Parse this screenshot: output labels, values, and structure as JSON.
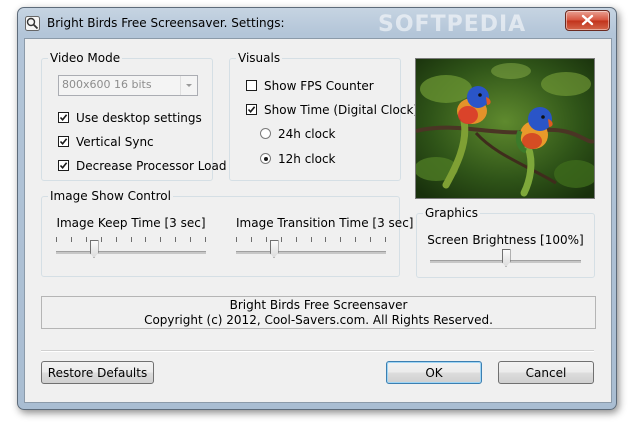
{
  "window": {
    "title": "Bright Birds Free Screensaver. Settings:",
    "watermark": "SOFTPEDIA"
  },
  "video_mode": {
    "group_label": "Video Mode",
    "resolution_value": "800x600 16 bits",
    "checkboxes": [
      {
        "label": "Use desktop settings",
        "checked": true
      },
      {
        "label": "Vertical Sync",
        "checked": true
      },
      {
        "label": "Decrease Processor Load",
        "checked": true
      }
    ]
  },
  "visuals": {
    "group_label": "Visuals",
    "checkboxes": [
      {
        "label": "Show FPS Counter",
        "checked": false
      },
      {
        "label": "Show Time (Digital Clock)",
        "checked": true
      }
    ],
    "radios": [
      {
        "label": "24h clock",
        "selected": false
      },
      {
        "label": "12h clock",
        "selected": true
      }
    ]
  },
  "image_show": {
    "group_label": "Image Show Control",
    "keep_time_label": "Image Keep Time [3 sec]",
    "keep_time_fraction": 0.25,
    "transition_time_label": "Image Transition Time [3 sec]",
    "transition_time_fraction": 0.25
  },
  "graphics": {
    "group_label": "Graphics",
    "brightness_label": "Screen Brightness [100%]",
    "brightness_fraction": 0.5
  },
  "info": {
    "line1": "Bright Birds Free Screensaver",
    "line2": "Copyright (c) 2012, Cool-Savers.com. All Rights Reserved."
  },
  "buttons": {
    "restore": "Restore Defaults",
    "ok": "OK",
    "cancel": "Cancel"
  },
  "colors": {
    "window_frame": "#b3c5d8",
    "close_button": "#c2331b",
    "dialog_face": "#f0f0f0"
  },
  "icons": [
    "app-icon",
    "close-icon",
    "check-icon",
    "combo-arrow-icon"
  ]
}
